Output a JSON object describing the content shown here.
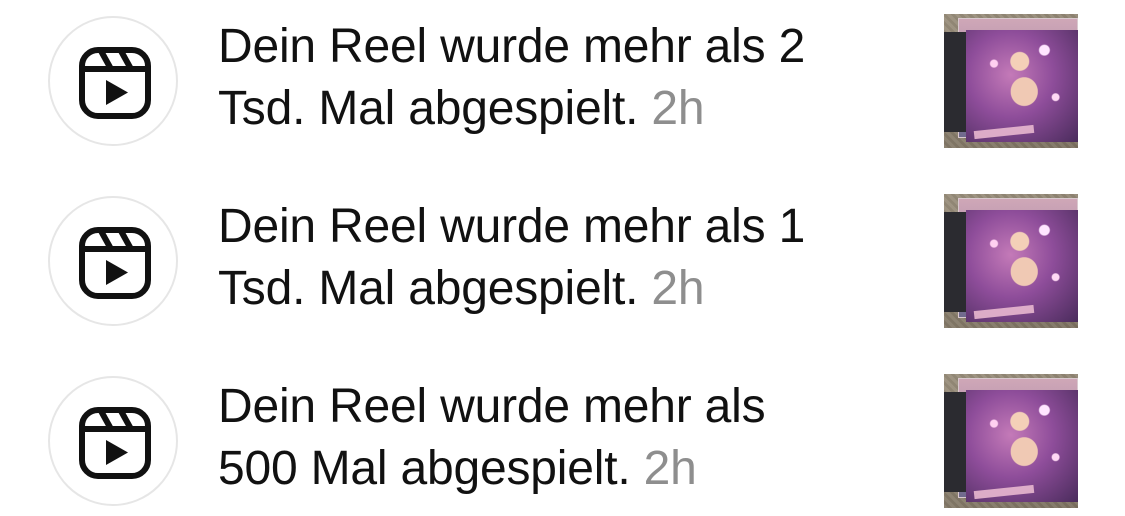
{
  "notifications": [
    {
      "icon": "reels-icon",
      "line1": "Dein Reel wurde mehr als 2",
      "line2": "Tsd. Mal abgespielt.",
      "time": "2h"
    },
    {
      "icon": "reels-icon",
      "line1": "Dein Reel wurde mehr als 1",
      "line2": "Tsd. Mal abgespielt.",
      "time": "2h"
    },
    {
      "icon": "reels-icon",
      "line1": "Dein Reel wurde mehr als",
      "line2": "500 Mal abgespielt.",
      "time": "2h"
    }
  ],
  "colors": {
    "text": "#111111",
    "timestamp": "#8e8e8e",
    "avatar_border": "#e6e6e6"
  }
}
